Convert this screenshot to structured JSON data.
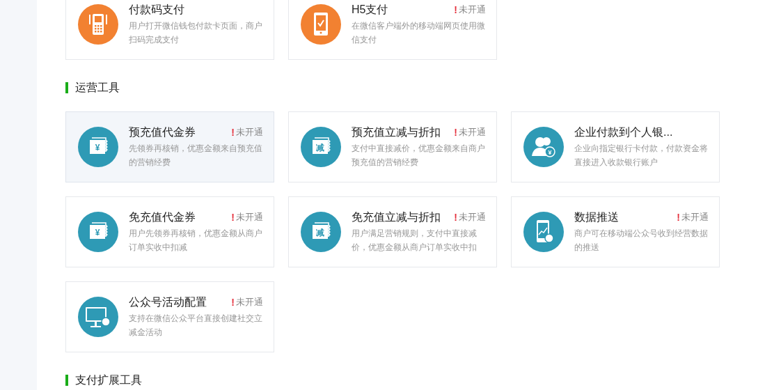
{
  "sections": [
    {
      "cards": [
        {
          "title": "付款码支付",
          "description": "用户打开微信钱包付款卡页面，商户扫码完成支付",
          "color": "#f28131",
          "highlighted": false
        },
        {
          "title": "H5支付",
          "status": {
            "mark": "!",
            "text": "未开通"
          },
          "description": "在微信客户端外的移动端网页使用微信支付",
          "color": "#f28131",
          "highlighted": false
        }
      ]
    },
    {
      "title": "运营工具",
      "cards": [
        {
          "title": "预充值代金券",
          "status": {
            "mark": "!",
            "text": "未开通"
          },
          "description": "先领券再核销，优惠金额来自预充值的营销经费",
          "color": "#2e9ab5",
          "icon_label": "¥",
          "highlighted": true
        },
        {
          "title": "预充值立减与折扣",
          "status": {
            "mark": "!",
            "text": "未开通"
          },
          "description": "支付中直接减价，优惠金额来自商户预充值的营销经费",
          "color": "#2e9ab5",
          "icon_label": "减",
          "highlighted": false
        },
        {
          "title": "企业付款到个人银...",
          "description": "企业向指定银行卡付款，付款资金将直接进入收款银行账户",
          "color": "#2e9ab5",
          "icon_label": "¥",
          "highlighted": false
        },
        {
          "title": "免充值代金券",
          "status": {
            "mark": "!",
            "text": "未开通"
          },
          "description": "用户先领券再核销，优惠金额从商户订单实收中扣减",
          "color": "#2e9ab5",
          "icon_label": "¥",
          "highlighted": false
        },
        {
          "title": "免充值立减与折扣",
          "status": {
            "mark": "!",
            "text": "未开通"
          },
          "description": "用户满足营销规则，支付中直接减价，优惠金额从商户订单实收中扣",
          "color": "#2e9ab5",
          "icon_label": "减",
          "highlighted": false
        },
        {
          "title": "数据推送",
          "status": {
            "mark": "!",
            "text": "未开通"
          },
          "description": "商户可在移动端公众号收到经营数据的推送",
          "color": "#2e9ab5",
          "highlighted": false
        },
        {
          "title": "公众号活动配置",
          "status": {
            "mark": "!",
            "text": "未开通"
          },
          "description": "支持在微信公众平台直接创建社交立减金活动",
          "color": "#2e9ab5",
          "highlighted": false
        }
      ]
    },
    {
      "title": "支付扩展工具"
    }
  ]
}
